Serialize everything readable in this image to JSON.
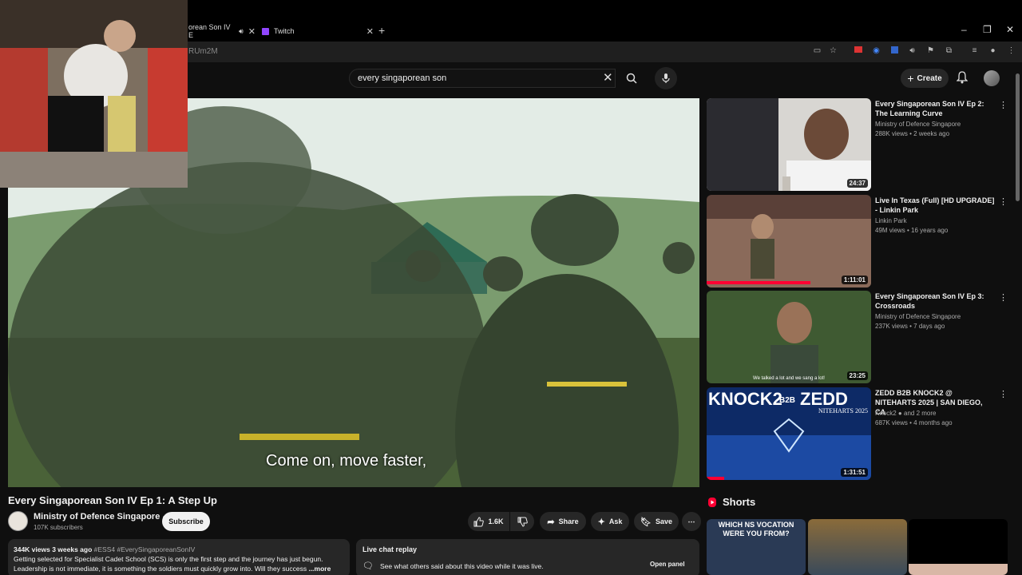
{
  "browser": {
    "tabs": [
      {
        "label": "orean Son IV E"
      },
      {
        "label": "Twitch"
      }
    ],
    "url": "RUm2M"
  },
  "header": {
    "search_value": "every singaporean son",
    "create_label": "Create"
  },
  "video": {
    "caption": "Come on, move faster,",
    "title": "Every Singaporean Son IV Ep 1: A Step Up",
    "channel": "Ministry of Defence Singapore",
    "subscribers": "107K subscribers",
    "subscribe_label": "Subscribe",
    "likes": "1.6K",
    "share_label": "Share",
    "ask_label": "Ask",
    "save_label": "Save"
  },
  "description": {
    "meta": "344K views  3 weeks ago",
    "hashtags": "#ESS4 #EverySingaporeanSonIV",
    "line1": "Getting selected for Specialist Cadet School (SCS) is only the first step and the journey has just begun.",
    "line2": "Leadership is not immediate, it is something the soldiers must quickly grow into. Will they success",
    "more": "...more"
  },
  "live_chat": {
    "title": "Live chat replay",
    "text": "See what others said about this video while it was live.",
    "button": "Open panel"
  },
  "recommendations": [
    {
      "title": "Every Singaporean Son IV Ep 2: The Learning Curve",
      "channel": "Ministry of Defence Singapore",
      "meta": "288K views • 2 weeks ago",
      "duration": "24:37"
    },
    {
      "title": "Live In Texas (Full) [HD UPGRADE] - Linkin Park",
      "channel": "Linkin Park",
      "meta": "49M views • 16 years ago",
      "duration": "1:11:01"
    },
    {
      "title": "Every Singaporean Son IV Ep 3: Crossroads",
      "channel": "Ministry of Defence Singapore",
      "meta": "237K views • 7 days ago",
      "duration": "23:25"
    },
    {
      "title": "ZEDD B2B KNOCK2 @ NITEHARTS 2025 | SAN DIEGO, CA",
      "channel": "Knock2",
      "channel_extra": "and 2 more",
      "meta": "687K views • 4 months ago",
      "duration": "1:31:51"
    }
  ],
  "thumb_text": {
    "ep3_sub": "We talked a lot and we sang a lot!",
    "zedd_left": "KNOCK2",
    "zedd_b2b": "B2B",
    "zedd_right": "ZEDD",
    "zedd_sub": "NITEHARTS 2025"
  },
  "shorts": {
    "title": "Shorts",
    "first_text": "WHICH NS VOCATION WERE YOU FROM?"
  },
  "colors": {
    "bg": "#0f0f0f",
    "accent_red": "#ff0033"
  }
}
